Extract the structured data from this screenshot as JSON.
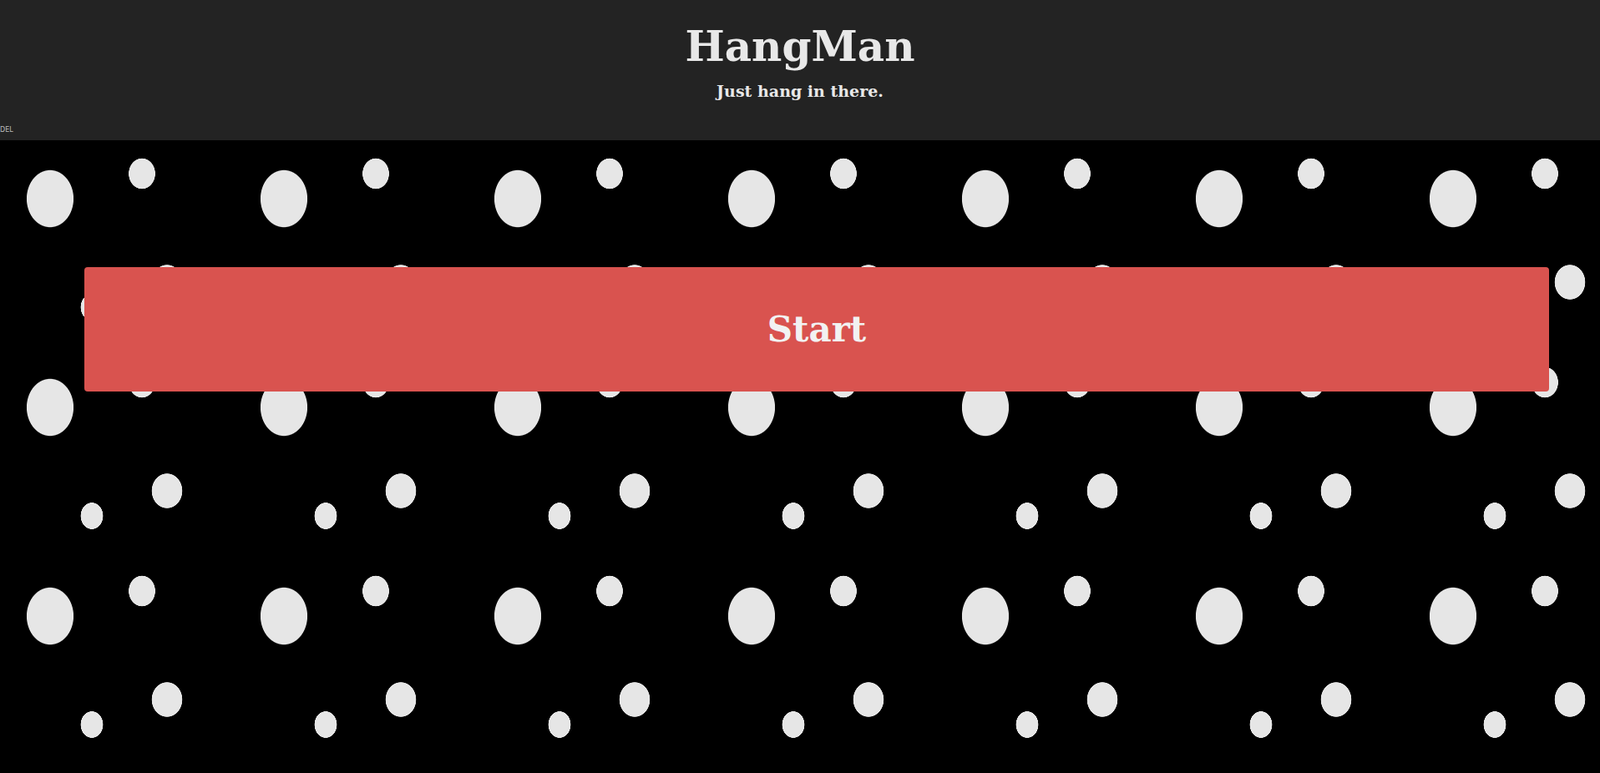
{
  "header": {
    "title": "HangMan",
    "subtitle": "Just hang in there."
  },
  "corner_label": "DEL",
  "start_button": {
    "label": "Start"
  }
}
